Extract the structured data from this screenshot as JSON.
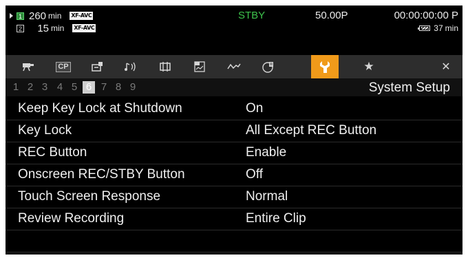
{
  "status": {
    "slot1": {
      "card": "1",
      "remaining": "260",
      "unit": "min",
      "format": "XF-AVC"
    },
    "slot2": {
      "card": "2",
      "remaining": "15",
      "unit": "min",
      "format": "XF-AVC"
    },
    "mode": "STBY",
    "frame_rate": "50.00P",
    "timecode": "00:00:00:00 P",
    "battery": {
      "value": "37",
      "unit": "min"
    }
  },
  "colors": {
    "stby": "#3dc24c",
    "active_tab": "#f09a1a",
    "card_active": "#2e8b3a"
  },
  "tabs": [
    {
      "icon": "camera-icon"
    },
    {
      "icon": "custom-picture-icon",
      "label": "CP"
    },
    {
      "icon": "recording-setup-icon"
    },
    {
      "icon": "audio-setup-icon"
    },
    {
      "icon": "video-setup-icon"
    },
    {
      "icon": "lcd-setup-icon"
    },
    {
      "icon": "assistance-functions-icon"
    },
    {
      "icon": "network-settings-icon"
    },
    {
      "icon": "system-setup-icon",
      "active": true
    },
    {
      "icon": "my-menu-icon",
      "label": "★"
    },
    {
      "icon": "close-icon",
      "label": "✕"
    }
  ],
  "pages": [
    "1",
    "2",
    "3",
    "4",
    "5",
    "6",
    "7",
    "8",
    "9"
  ],
  "current_page": "6",
  "section_title": "System Setup",
  "menu": [
    {
      "label": "Keep Key Lock at Shutdown",
      "value": "On"
    },
    {
      "label": "Key Lock",
      "value": "All Except REC Button"
    },
    {
      "label": "REC Button",
      "value": "Enable"
    },
    {
      "label": "Onscreen REC/STBY Button",
      "value": "Off"
    },
    {
      "label": "Touch Screen Response",
      "value": "Normal"
    },
    {
      "label": "Review Recording",
      "value": "Entire Clip"
    },
    {
      "label": "",
      "value": ""
    }
  ]
}
